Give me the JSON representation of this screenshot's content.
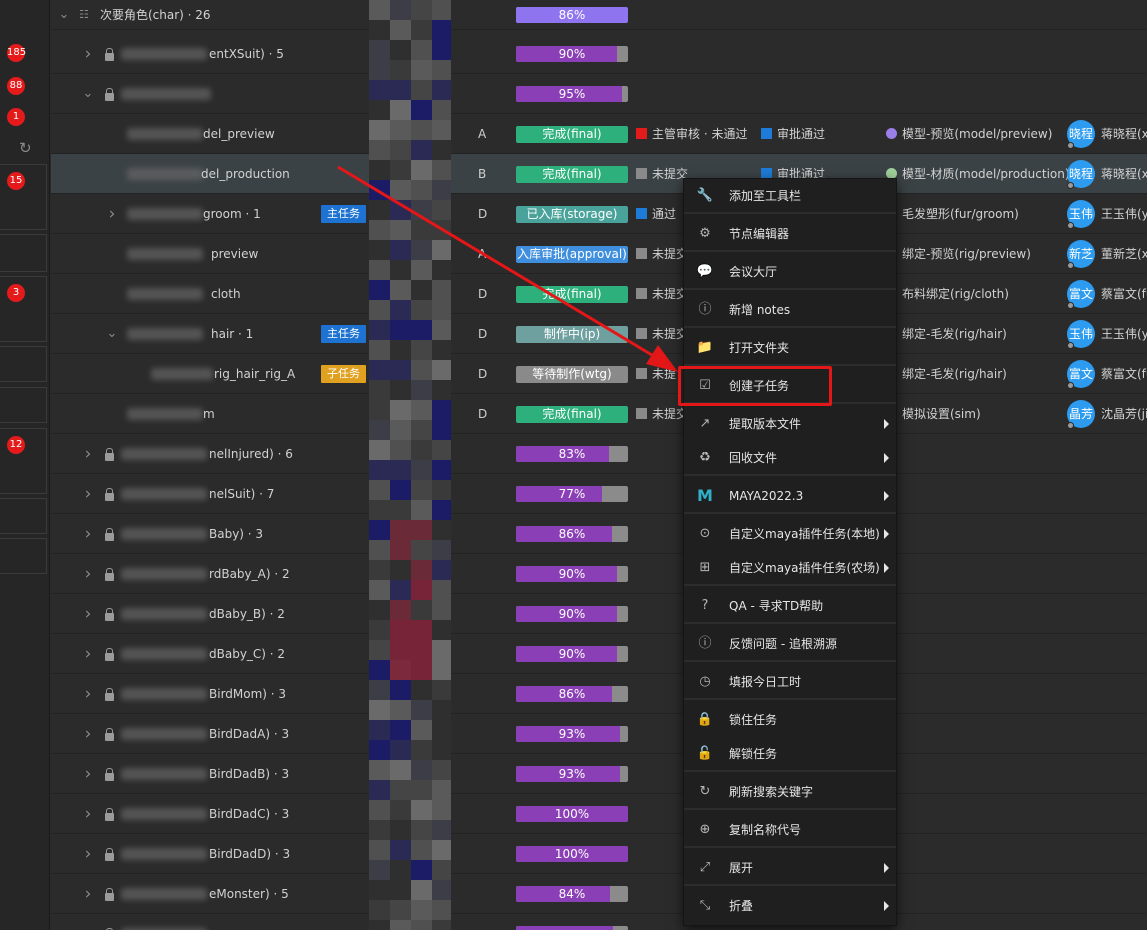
{
  "sidebar": {
    "badges": [
      "185",
      "88",
      "1",
      "15",
      "3",
      "12"
    ],
    "refresh_icon": "refresh-icon"
  },
  "group": {
    "title": "次要角色(char) · 26",
    "progress_label": "86%",
    "progress": 0.86
  },
  "tree": [
    {
      "label": "entXSuit) · 5",
      "progress_label": "90%",
      "progress": 0.9
    },
    {
      "label": "",
      "progress_label": "95%",
      "progress": 0.95
    },
    {
      "label": "del_preview",
      "grade": "A",
      "status": "完成(final)",
      "status_color": "#2eb07c",
      "check1_color": "#e31b1b",
      "check1": "主管审核 · 未通过",
      "check2_color": "#1e7bd8",
      "check2": "审批通过",
      "dot_color": "#9b7fe8",
      "stage": "模型-预览(model/preview)",
      "avatar": "晓程",
      "user": "蒋晓程(x"
    },
    {
      "label": "del_production",
      "grade": "B",
      "status": "完成(final)",
      "status_color": "#2eb07c",
      "check1_color": "#8a8a8a",
      "check1": "未提交",
      "check2_color": "#1e7bd8",
      "check2": "审批通过",
      "dot_color": "#9fd09a",
      "stage": "模型-材质(model/production)",
      "avatar": "晓程",
      "user": "蒋晓程(x"
    },
    {
      "label": "groom · 1",
      "tag": "主任务",
      "tag_color": "#1e72d1",
      "grade": "D",
      "status": "已入库(storage)",
      "status_color": "#4aa39a",
      "check1_color": "#1e7bd8",
      "check1": "通过",
      "stage": "毛发塑形(fur/groom)",
      "avatar": "玉伟",
      "user": "王玉伟(y"
    },
    {
      "label": "preview",
      "grade": "A",
      "status": "入库审批(approval)",
      "status_color": "#3f8fde",
      "check1_color": "#8a8a8a",
      "check1": "未提交",
      "stage": "绑定-预览(rig/preview)",
      "avatar": "新芝",
      "user": "董新芝(x"
    },
    {
      "label": "cloth",
      "grade": "D",
      "status": "完成(final)",
      "status_color": "#2eb07c",
      "check1_color": "#8a8a8a",
      "check1": "未提交",
      "stage": "布料绑定(rig/cloth)",
      "avatar": "富文",
      "user": "蔡富文(fu"
    },
    {
      "label": "hair · 1",
      "tag": "主任务",
      "tag_color": "#1e72d1",
      "grade": "D",
      "status": "制作中(ip)",
      "status_color": "#6fa0a0",
      "check1_color": "#8a8a8a",
      "check1": "未提交",
      "stage": "绑定-毛发(rig/hair)",
      "avatar": "玉伟",
      "user": "王玉伟(y"
    },
    {
      "label": "rig_hair_rig_A",
      "tag": "子任务",
      "tag_color": "#e0a020",
      "grade": "D",
      "status": "等待制作(wtg)",
      "status_color": "#8a8a8a",
      "check1_color": "#8a8a8a",
      "check1": "未提",
      "stage": "绑定-毛发(rig/hair)",
      "avatar": "富文",
      "user": "蔡富文(fu"
    },
    {
      "label": "m",
      "grade": "D",
      "status": "完成(final)",
      "status_color": "#2eb07c",
      "check1_color": "#8a8a8a",
      "check1": "未提交",
      "stage": "模拟设置(sim)",
      "avatar": "晶芳",
      "user": "沈晶芳(ji"
    },
    {
      "label": "nelInjured) · 6",
      "progress_label": "83%",
      "progress": 0.83
    },
    {
      "label": "nelSuit) · 7",
      "progress_label": "77%",
      "progress": 0.77
    },
    {
      "label": "Baby) · 3",
      "progress_label": "86%",
      "progress": 0.86
    },
    {
      "label": "rdBaby_A) · 2",
      "progress_label": "90%",
      "progress": 0.9
    },
    {
      "label": "dBaby_B) · 2",
      "progress_label": "90%",
      "progress": 0.9
    },
    {
      "label": "dBaby_C) · 2",
      "progress_label": "90%",
      "progress": 0.9
    },
    {
      "label": "BirdMom) · 3",
      "progress_label": "86%",
      "progress": 0.86
    },
    {
      "label": "BirdDadA) · 3",
      "progress_label": "93%",
      "progress": 0.93
    },
    {
      "label": "BirdDadB) · 3",
      "progress_label": "93%",
      "progress": 0.93
    },
    {
      "label": "BirdDadC) · 3",
      "progress_label": "100%",
      "progress": 1.0
    },
    {
      "label": "BirdDadD) · 3",
      "progress_label": "100%",
      "progress": 1.0
    },
    {
      "label": "eMonster) · 5",
      "progress_label": "84%",
      "progress": 0.84
    },
    {
      "label": "",
      "progress_label": "",
      "progress": 0.87
    }
  ],
  "context_menu": {
    "items": [
      {
        "icon": "wrench-icon",
        "glyph": "🔧",
        "label": "添加至工具栏"
      },
      {
        "icon": "node-editor-icon",
        "glyph": "⚙",
        "label": "节点编辑器"
      },
      {
        "icon": "chat-icon",
        "glyph": "💬",
        "label": "会议大厅"
      },
      {
        "icon": "info-icon",
        "glyph": "ⓘ",
        "label": "新增 notes"
      },
      {
        "icon": "folder-icon",
        "glyph": "📁",
        "label": "打开文件夹"
      },
      {
        "icon": "checkbox-icon",
        "glyph": "☑",
        "label": "创建子任务"
      },
      {
        "icon": "share-icon",
        "glyph": "↗",
        "label": "提取版本文件",
        "sub": true
      },
      {
        "icon": "recycle-icon",
        "glyph": "♻",
        "label": "回收文件",
        "sub": true
      },
      {
        "icon": "maya-icon",
        "glyph": "M",
        "label": "MAYA2022.3",
        "sub": true
      },
      {
        "icon": "location-icon",
        "glyph": "⊙",
        "label": "自定义maya插件任务(本地)",
        "sub": true
      },
      {
        "icon": "network-icon",
        "glyph": "⊞",
        "label": "自定义maya插件任务(农场)",
        "sub": true
      },
      {
        "icon": "question-icon",
        "glyph": "?",
        "label": "QA - 寻求TD帮助"
      },
      {
        "icon": "feedback-icon",
        "glyph": "ⓘ",
        "label": "反馈问题 - 追根溯源"
      },
      {
        "icon": "clock-icon",
        "glyph": "◷",
        "label": "填报今日工时"
      },
      {
        "icon": "lock-icon",
        "glyph": "🔒",
        "label": "锁住任务"
      },
      {
        "icon": "unlock-icon",
        "glyph": "🔓",
        "label": "解锁任务"
      },
      {
        "icon": "refresh-icon",
        "glyph": "↻",
        "label": "刷新搜索关键字"
      },
      {
        "icon": "copy-icon",
        "glyph": "⊕",
        "label": "复制名称代号"
      },
      {
        "icon": "expand-icon",
        "glyph": "⤢",
        "label": "展开",
        "sub": true
      },
      {
        "icon": "collapse-icon",
        "glyph": "⤡",
        "label": "折叠",
        "sub": true
      }
    ]
  },
  "colors": {
    "accent_red": "#e31717",
    "progress_purple": "#8a3fb7",
    "header_bar": "#8f74f0"
  }
}
